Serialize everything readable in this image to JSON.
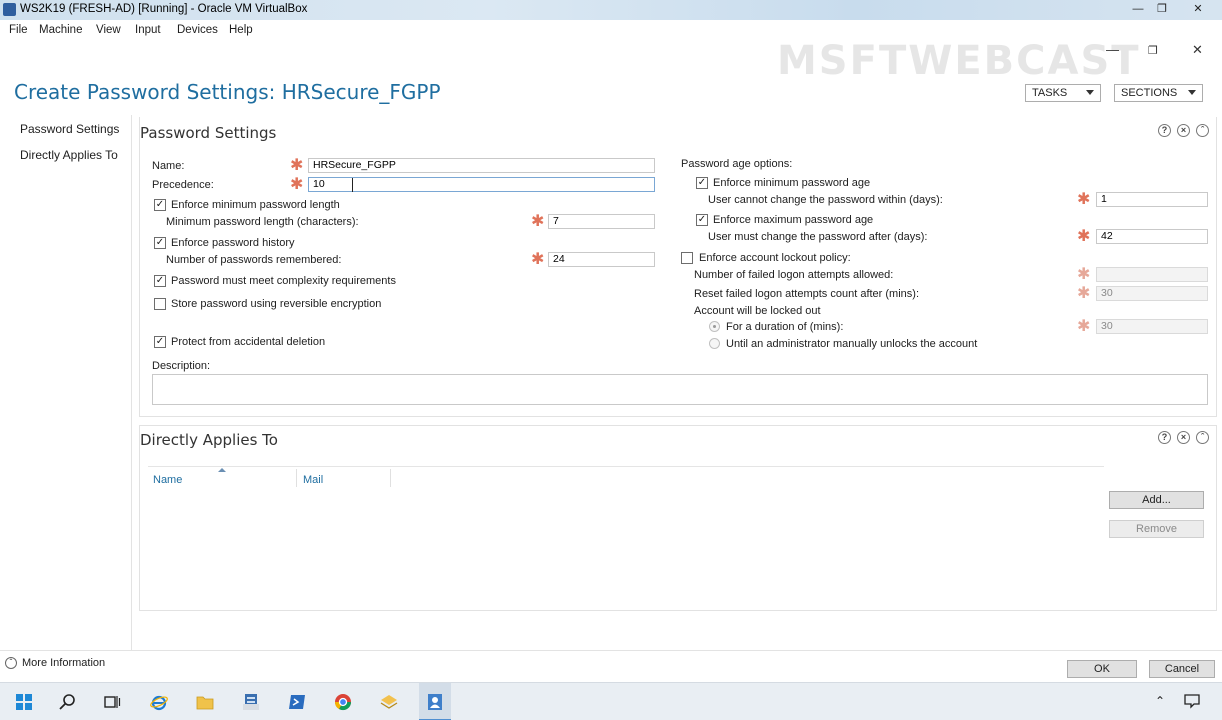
{
  "vbox": {
    "title": "WS2K19 (FRESH-AD) [Running] - Oracle VM VirtualBox",
    "menu": [
      "File",
      "Machine",
      "View",
      "Input",
      "Devices",
      "Help"
    ]
  },
  "watermark": "MSFTWEBCAST",
  "page": {
    "title": "Create Password Settings: HRSecure_FGPP",
    "tasks_label": "TASKS",
    "sections_label": "SECTIONS"
  },
  "nav": {
    "items": [
      "Password Settings",
      "Directly Applies To"
    ]
  },
  "password_settings": {
    "title": "Password Settings",
    "name_label": "Name:",
    "name_value": "HRSecure_FGPP",
    "precedence_label": "Precedence:",
    "precedence_value": "10",
    "enforce_min_length_label": "Enforce minimum password length",
    "enforce_min_length_checked": true,
    "min_length_label": "Minimum password length (characters):",
    "min_length_value": "7",
    "enforce_history_label": "Enforce password history",
    "enforce_history_checked": true,
    "history_label": "Number of passwords remembered:",
    "history_value": "24",
    "complexity_label": "Password must meet complexity requirements",
    "complexity_checked": true,
    "reversible_label": "Store password using reversible encryption",
    "reversible_checked": false,
    "protect_label": "Protect from accidental deletion",
    "protect_checked": true,
    "description_label": "Description:",
    "description_value": "",
    "age_options_label": "Password age options:",
    "enforce_min_age_label": "Enforce minimum password age",
    "enforce_min_age_checked": true,
    "min_age_label": "User cannot change the password within (days):",
    "min_age_value": "1",
    "enforce_max_age_label": "Enforce maximum password age",
    "enforce_max_age_checked": true,
    "max_age_label": "User must change the password after (days):",
    "max_age_value": "42",
    "lockout_label": "Enforce account lockout policy:",
    "lockout_checked": false,
    "failed_attempts_label": "Number of failed logon attempts allowed:",
    "failed_attempts_value": "",
    "reset_count_label": "Reset failed logon attempts count after (mins):",
    "reset_count_value": "30",
    "locked_out_label": "Account will be locked out",
    "duration_label": "For a duration of (mins):",
    "duration_value": "30",
    "until_admin_label": "Until an administrator manually unlocks the account"
  },
  "applies_to": {
    "title": "Directly Applies To",
    "columns": [
      "Name",
      "Mail"
    ],
    "add_label": "Add...",
    "remove_label": "Remove"
  },
  "footer": {
    "more_info": "More Information",
    "ok": "OK",
    "cancel": "Cancel"
  },
  "colors": {
    "title_blue": "#1f6ea0",
    "required_asterisk": "#e0735a"
  },
  "taskbar": {
    "icons": [
      "windows-start-icon",
      "search-icon",
      "task-view-icon",
      "internet-explorer-icon",
      "file-explorer-icon",
      "server-manager-icon",
      "powershell-icon",
      "chrome-icon",
      "folder-archive-icon",
      "ad-admin-center-icon"
    ]
  }
}
